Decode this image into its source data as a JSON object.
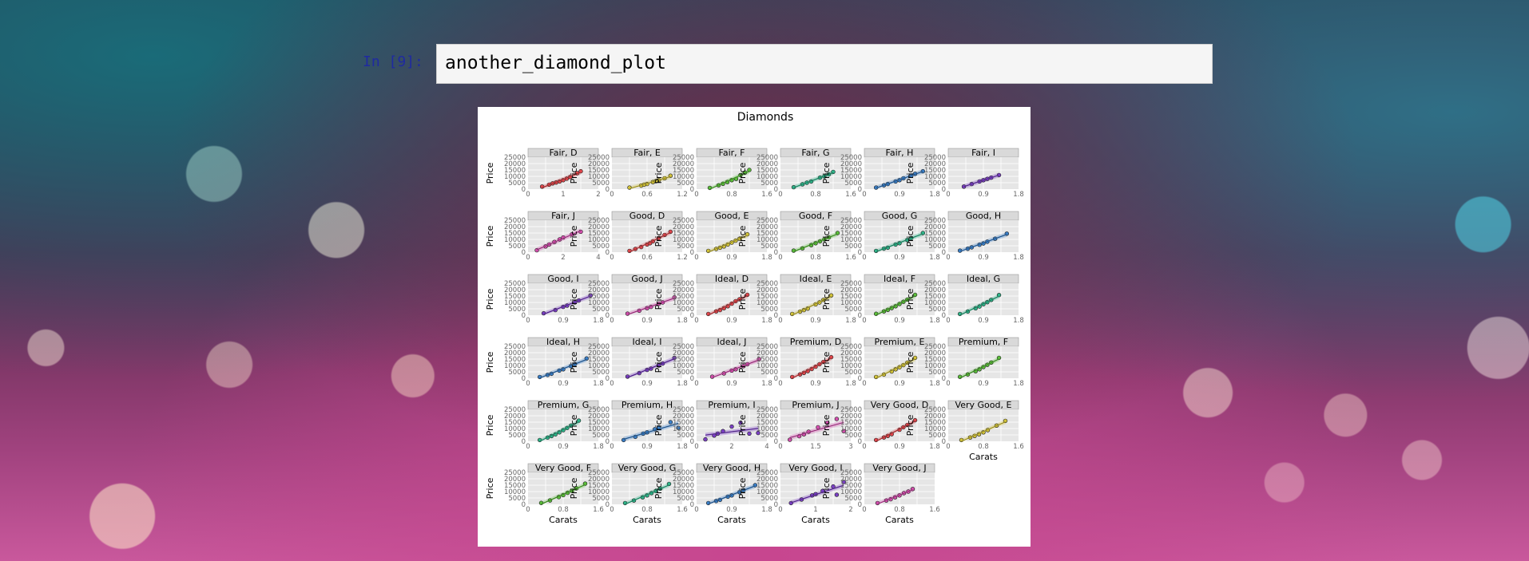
{
  "cell": {
    "prompt": "In [9]:",
    "code": "another_diamond_plot"
  },
  "figure": {
    "title": "Diamonds"
  },
  "chart_data": {
    "type": "scatter",
    "title": "Diamonds",
    "xlabel": "Carats",
    "ylabel": "Price",
    "grid": true,
    "ylim": [
      0,
      25000
    ],
    "yticks": [
      "0",
      "5000",
      "10000",
      "15000",
      "20000",
      "25000"
    ],
    "smoother": true,
    "colors": {
      "D": "#e0474c",
      "E": "#d3c43a",
      "F": "#5bbf3a",
      "G": "#2fb58a",
      "H": "#3a7fc8",
      "I": "#7a3fc4",
      "J": "#d44fae"
    },
    "panels": [
      {
        "label": "Fair, D",
        "color": "D",
        "xticks": [
          "0",
          "1",
          "2"
        ],
        "xmax": 2,
        "x": [
          0.4,
          0.6,
          0.8,
          1.0,
          1.2,
          1.4,
          0.9,
          1.1,
          1.5,
          0.7
        ],
        "y": [
          2000,
          3500,
          5200,
          7000,
          9500,
          12500,
          6000,
          8200,
          14000,
          4500
        ]
      },
      {
        "label": "Fair, E",
        "color": "E",
        "xticks": [
          "0",
          "0.6",
          "1.2"
        ],
        "xmax": 1.2,
        "x": [
          0.3,
          0.5,
          0.6,
          0.7,
          0.8,
          0.9,
          1.0,
          0.55,
          0.75
        ],
        "y": [
          1200,
          2800,
          4000,
          5500,
          7000,
          8500,
          10500,
          3500,
          6200
        ]
      },
      {
        "label": "Fair, F",
        "color": "F",
        "xticks": [
          "0",
          "0.8",
          "1.6"
        ],
        "xmax": 1.6,
        "x": [
          0.3,
          0.5,
          0.7,
          0.9,
          1.0,
          1.2,
          0.8,
          1.1,
          0.6
        ],
        "y": [
          1000,
          3000,
          5500,
          8000,
          11000,
          15000,
          7000,
          13000,
          4200
        ]
      },
      {
        "label": "Fair, G",
        "color": "G",
        "xticks": [
          "0",
          "0.8",
          "1.6"
        ],
        "xmax": 1.6,
        "x": [
          0.3,
          0.5,
          0.7,
          0.9,
          1.1,
          1.2,
          0.6,
          1.0
        ],
        "y": [
          1500,
          3800,
          6000,
          9000,
          11500,
          13500,
          5000,
          10000
        ]
      },
      {
        "label": "Fair, H",
        "color": "H",
        "xticks": [
          "0",
          "0.9",
          "1.8"
        ],
        "xmax": 1.8,
        "x": [
          0.3,
          0.6,
          0.9,
          1.2,
          1.5,
          0.8,
          1.0,
          1.3,
          0.5
        ],
        "y": [
          1200,
          4000,
          7000,
          10500,
          14000,
          6000,
          8500,
          12000,
          3000
        ]
      },
      {
        "label": "Fair, I",
        "color": "I",
        "xticks": [
          "0",
          "0.9",
          "1.8"
        ],
        "xmax": 1.8,
        "x": [
          0.4,
          0.6,
          0.9,
          1.1,
          1.3,
          0.8,
          1.0
        ],
        "y": [
          2000,
          4000,
          7000,
          9000,
          11000,
          6000,
          8000
        ]
      },
      {
        "label": "Fair, J",
        "color": "J",
        "xticks": [
          "0",
          "2",
          "4"
        ],
        "xmax": 4,
        "x": [
          0.5,
          1.0,
          1.5,
          2.0,
          2.5,
          3.0,
          1.2,
          1.8
        ],
        "y": [
          1500,
          4500,
          8000,
          11500,
          14000,
          16000,
          6000,
          10000
        ]
      },
      {
        "label": "Good, D",
        "color": "D",
        "xticks": [
          "0",
          "0.6",
          "1.2"
        ],
        "xmax": 1.2,
        "x": [
          0.3,
          0.4,
          0.5,
          0.6,
          0.7,
          0.8,
          0.9,
          1.0,
          0.65
        ],
        "y": [
          1000,
          2500,
          4000,
          6000,
          8500,
          11000,
          13500,
          16000,
          7000
        ]
      },
      {
        "label": "Good, E",
        "color": "E",
        "xticks": [
          "0",
          "0.9",
          "1.8"
        ],
        "xmax": 1.8,
        "x": [
          0.3,
          0.5,
          0.7,
          0.9,
          1.1,
          1.3,
          0.8,
          1.0,
          0.6
        ],
        "y": [
          1000,
          2500,
          4500,
          7500,
          10500,
          14000,
          6000,
          9000,
          3500
        ]
      },
      {
        "label": "Good, F",
        "color": "F",
        "xticks": [
          "0",
          "0.8",
          "1.6"
        ],
        "xmax": 1.6,
        "x": [
          0.3,
          0.5,
          0.7,
          0.9,
          1.1,
          1.3,
          0.8,
          1.0
        ],
        "y": [
          1200,
          3000,
          5500,
          8500,
          11500,
          15000,
          7000,
          10000
        ]
      },
      {
        "label": "Good, G",
        "color": "G",
        "xticks": [
          "0",
          "0.9",
          "1.8"
        ],
        "xmax": 1.8,
        "x": [
          0.3,
          0.6,
          0.9,
          1.2,
          1.5,
          0.8,
          1.1,
          0.5
        ],
        "y": [
          1000,
          3500,
          7000,
          11000,
          15000,
          6000,
          9500,
          2800
        ]
      },
      {
        "label": "Good, H",
        "color": "H",
        "xticks": [
          "0",
          "0.9",
          "1.8"
        ],
        "xmax": 1.8,
        "x": [
          0.3,
          0.6,
          0.9,
          1.2,
          1.5,
          0.8,
          1.0,
          0.5
        ],
        "y": [
          1200,
          3800,
          6800,
          10500,
          14500,
          5800,
          8200,
          2700
        ]
      },
      {
        "label": "Good, I",
        "color": "I",
        "xticks": [
          "0",
          "0.9",
          "1.8"
        ],
        "xmax": 1.8,
        "x": [
          0.4,
          0.7,
          1.0,
          1.3,
          1.6,
          0.9,
          1.2
        ],
        "y": [
          1500,
          4000,
          7500,
          11500,
          15500,
          6500,
          10000
        ]
      },
      {
        "label": "Good, J",
        "color": "J",
        "xticks": [
          "0",
          "0.9",
          "1.8"
        ],
        "xmax": 1.8,
        "x": [
          0.4,
          0.7,
          1.0,
          1.3,
          1.6,
          0.9,
          1.2
        ],
        "y": [
          1200,
          3500,
          6500,
          10000,
          14000,
          5500,
          9000
        ]
      },
      {
        "label": "Ideal, D",
        "color": "D",
        "xticks": [
          "0",
          "0.9",
          "1.8"
        ],
        "xmax": 1.8,
        "x": [
          0.3,
          0.5,
          0.7,
          0.9,
          1.1,
          1.3,
          0.6,
          1.0,
          0.8
        ],
        "y": [
          1000,
          3000,
          5500,
          9000,
          12500,
          16000,
          4000,
          11000,
          7000
        ]
      },
      {
        "label": "Ideal, E",
        "color": "E",
        "xticks": [
          "0",
          "0.9",
          "1.8"
        ],
        "xmax": 1.8,
        "x": [
          0.3,
          0.5,
          0.7,
          0.9,
          1.1,
          1.3,
          0.6,
          1.0
        ],
        "y": [
          1000,
          2800,
          5200,
          8500,
          12000,
          15500,
          4000,
          10000
        ]
      },
      {
        "label": "Ideal, F",
        "color": "F",
        "xticks": [
          "0",
          "0.9",
          "1.8"
        ],
        "xmax": 1.8,
        "x": [
          0.3,
          0.5,
          0.7,
          0.9,
          1.1,
          1.3,
          0.8,
          1.0,
          0.6
        ],
        "y": [
          1100,
          3000,
          5600,
          8800,
          12200,
          16000,
          7000,
          10500,
          4200
        ]
      },
      {
        "label": "Ideal, G",
        "color": "G",
        "xticks": [
          "0",
          "0.9",
          "1.8"
        ],
        "xmax": 1.8,
        "x": [
          0.3,
          0.5,
          0.7,
          0.9,
          1.1,
          1.3,
          0.8,
          1.0
        ],
        "y": [
          1000,
          2900,
          5400,
          8600,
          12000,
          15800,
          6800,
          10200
        ]
      },
      {
        "label": "Ideal, H",
        "color": "H",
        "xticks": [
          "0",
          "0.9",
          "1.8"
        ],
        "xmax": 1.8,
        "x": [
          0.3,
          0.6,
          0.9,
          1.2,
          1.5,
          0.8,
          1.1,
          0.5
        ],
        "y": [
          1000,
          3500,
          7000,
          11000,
          15500,
          6000,
          9500,
          2600
        ]
      },
      {
        "label": "Ideal, I",
        "color": "I",
        "xticks": [
          "0",
          "0.9",
          "1.8"
        ],
        "xmax": 1.8,
        "x": [
          0.4,
          0.7,
          1.0,
          1.3,
          1.6,
          0.9,
          1.2
        ],
        "y": [
          1300,
          4000,
          7500,
          11500,
          16000,
          6500,
          10000
        ]
      },
      {
        "label": "Ideal, J",
        "color": "J",
        "xticks": [
          "0",
          "0.9",
          "1.8"
        ],
        "xmax": 1.8,
        "x": [
          0.4,
          0.7,
          1.0,
          1.3,
          1.6,
          0.9,
          1.2
        ],
        "y": [
          1200,
          3800,
          7000,
          11000,
          15000,
          6000,
          9500
        ]
      },
      {
        "label": "Premium, D",
        "color": "D",
        "xticks": [
          "0",
          "0.9",
          "1.8"
        ],
        "xmax": 1.8,
        "x": [
          0.3,
          0.5,
          0.7,
          0.9,
          1.1,
          1.3,
          0.6,
          1.0,
          0.8
        ],
        "y": [
          1000,
          3000,
          5600,
          9000,
          12800,
          16500,
          4200,
          11000,
          7200
        ]
      },
      {
        "label": "Premium, E",
        "color": "E",
        "xticks": [
          "0",
          "0.9",
          "1.8"
        ],
        "xmax": 1.8,
        "x": [
          0.3,
          0.5,
          0.7,
          0.9,
          1.1,
          1.3,
          0.8,
          1.0
        ],
        "y": [
          1000,
          2900,
          5300,
          8600,
          12200,
          16000,
          7000,
          10300
        ]
      },
      {
        "label": "Premium, F",
        "color": "F",
        "xticks": [
          "0",
          "0.9",
          "1.8"
        ],
        "xmax": 1.8,
        "x": [
          0.3,
          0.5,
          0.7,
          0.9,
          1.1,
          1.3,
          0.8,
          1.0
        ],
        "y": [
          1100,
          3000,
          5500,
          8800,
          12300,
          16000,
          7000,
          10500
        ]
      },
      {
        "label": "Premium, G",
        "color": "G",
        "xticks": [
          "0",
          "0.9",
          "1.8"
        ],
        "xmax": 1.8,
        "x": [
          0.3,
          0.5,
          0.7,
          0.9,
          1.1,
          1.3,
          0.8,
          1.0,
          0.6
        ],
        "y": [
          1000,
          2900,
          5400,
          8700,
          12300,
          16200,
          7000,
          10400,
          4100
        ]
      },
      {
        "label": "Premium, H",
        "color": "H",
        "xticks": [
          "0",
          "0.9",
          "1.8"
        ],
        "xmax": 1.8,
        "x": [
          0.3,
          0.6,
          0.9,
          1.2,
          1.5,
          0.8,
          1.1,
          1.7
        ],
        "y": [
          1000,
          3500,
          7000,
          11000,
          15000,
          6000,
          9500,
          10500
        ]
      },
      {
        "label": "Premium, I",
        "color": "I",
        "xticks": [
          "0",
          "2",
          "4"
        ],
        "xmax": 4,
        "x": [
          0.5,
          1.0,
          1.5,
          2.0,
          2.5,
          3.0,
          3.5,
          1.2
        ],
        "y": [
          1500,
          4500,
          8000,
          11500,
          14500,
          6000,
          6500,
          6000
        ]
      },
      {
        "label": "Premium, J",
        "color": "J",
        "xticks": [
          "0",
          "1.5",
          "3"
        ],
        "xmax": 3,
        "x": [
          0.4,
          0.8,
          1.2,
          1.6,
          2.0,
          2.4,
          1.0,
          2.7
        ],
        "y": [
          1200,
          4000,
          7500,
          11000,
          14500,
          17500,
          5500,
          8000
        ]
      },
      {
        "label": "Very Good, D",
        "color": "D",
        "xticks": [
          "0",
          "0.9",
          "1.8"
        ],
        "xmax": 1.8,
        "x": [
          0.3,
          0.5,
          0.7,
          0.9,
          1.1,
          1.3,
          0.6,
          1.0
        ],
        "y": [
          1000,
          3000,
          5600,
          9000,
          12800,
          16500,
          4200,
          11000
        ]
      },
      {
        "label": "Very Good, E",
        "color": "E",
        "xticks": [
          "0",
          "0.8",
          "1.6"
        ],
        "xmax": 1.6,
        "x": [
          0.3,
          0.5,
          0.7,
          0.9,
          1.1,
          1.3,
          0.8,
          0.6
        ],
        "y": [
          1000,
          3000,
          5500,
          8800,
          12300,
          16000,
          7000,
          4200
        ]
      },
      {
        "label": "Very Good, F",
        "color": "F",
        "xticks": [
          "0",
          "0.8",
          "1.6"
        ],
        "xmax": 1.6,
        "x": [
          0.3,
          0.5,
          0.7,
          0.9,
          1.1,
          1.3,
          0.8,
          1.0
        ],
        "y": [
          1100,
          3100,
          5700,
          9000,
          12500,
          16200,
          7200,
          10500
        ]
      },
      {
        "label": "Very Good, G",
        "color": "G",
        "xticks": [
          "0",
          "0.8",
          "1.6"
        ],
        "xmax": 1.6,
        "x": [
          0.3,
          0.5,
          0.7,
          0.9,
          1.1,
          1.3,
          0.8,
          1.0
        ],
        "y": [
          1000,
          3000,
          5500,
          8800,
          12300,
          16000,
          7000,
          10400
        ]
      },
      {
        "label": "Very Good, H",
        "color": "H",
        "xticks": [
          "0",
          "0.9",
          "1.8"
        ],
        "xmax": 1.8,
        "x": [
          0.3,
          0.6,
          0.9,
          1.2,
          1.5,
          0.8,
          1.1,
          0.5
        ],
        "y": [
          1000,
          3500,
          7000,
          11000,
          15000,
          6000,
          9500,
          2600
        ]
      },
      {
        "label": "Very Good, I",
        "color": "I",
        "xticks": [
          "0",
          "1",
          "2"
        ],
        "xmax": 2,
        "x": [
          0.3,
          0.6,
          0.9,
          1.2,
          1.5,
          1.8,
          1.0,
          1.6
        ],
        "y": [
          1000,
          3800,
          7000,
          10500,
          14000,
          17500,
          8000,
          7500
        ]
      },
      {
        "label": "Very Good, J",
        "color": "J",
        "xticks": [
          "0",
          "0.8",
          "1.6"
        ],
        "xmax": 1.6,
        "x": [
          0.3,
          0.5,
          0.7,
          0.9,
          1.1,
          0.8,
          1.0,
          0.6
        ],
        "y": [
          1000,
          3000,
          5500,
          8800,
          12000,
          7000,
          10000,
          4000
        ]
      }
    ]
  }
}
